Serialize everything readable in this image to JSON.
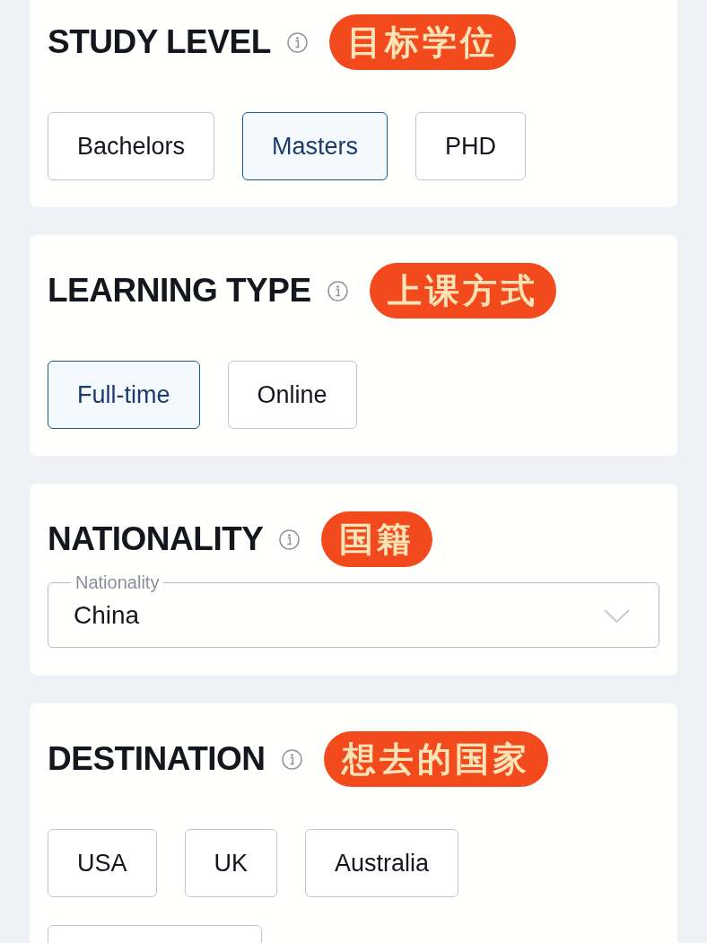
{
  "sections": [
    {
      "kind": "options",
      "title": "STUDY LEVEL",
      "annotation": "目标学位",
      "options": [
        {
          "label": "Bachelors",
          "selected": false
        },
        {
          "label": "Masters",
          "selected": true
        },
        {
          "label": "PHD",
          "selected": false
        }
      ]
    },
    {
      "kind": "options",
      "title": "LEARNING TYPE",
      "annotation": "上课方式",
      "options": [
        {
          "label": "Full-time",
          "selected": true
        },
        {
          "label": "Online",
          "selected": false
        }
      ]
    },
    {
      "kind": "select",
      "title": "NATIONALITY",
      "annotation": "国籍",
      "field": {
        "label": "Nationality",
        "value": "China"
      }
    },
    {
      "kind": "options",
      "title": "DESTINATION",
      "annotation": "想去的国家",
      "options": [
        {
          "label": "USA",
          "selected": false
        },
        {
          "label": "UK",
          "selected": false
        },
        {
          "label": "Australia",
          "selected": false
        },
        {
          "selected": false
        }
      ]
    }
  ]
}
